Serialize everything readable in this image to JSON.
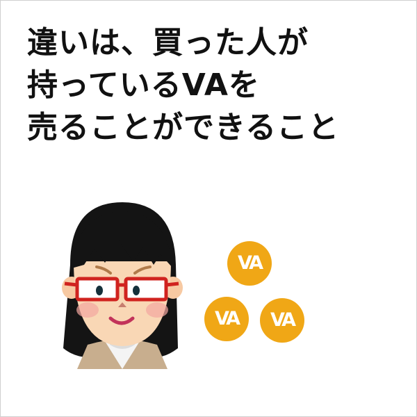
{
  "headline": {
    "lines": [
      "違いは、買った人が",
      "持っているVAを",
      "売ることができること"
    ]
  },
  "coins": [
    {
      "label": "VA"
    },
    {
      "label": "VA"
    },
    {
      "label": "VA"
    }
  ],
  "colors": {
    "coin": "#f0a716",
    "text": "#111111",
    "glasses": "#d0231f",
    "hair": "#111111",
    "jacket": "#c8ae8e"
  }
}
